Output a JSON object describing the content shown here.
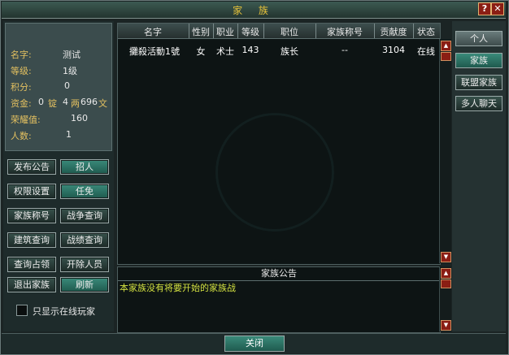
{
  "window": {
    "title": "家 族",
    "help": "?",
    "close": "✕"
  },
  "info": {
    "name_label": "名字:",
    "name_value": "测试",
    "level_label": "等级:",
    "level_value": "1级",
    "points_label": "积分:",
    "points_value": "0",
    "funds_label": "资金:",
    "funds_gold": "0",
    "funds_gold_unit": "锭",
    "funds_silver": "4",
    "funds_silver_unit": "两",
    "funds_copper": "696",
    "funds_copper_unit": "文",
    "honor_label": "荣耀值:",
    "honor_value": "160",
    "members_label": "人数:",
    "members_value": "1"
  },
  "buttons": {
    "post_notice": "发布公告",
    "recruit": "招人",
    "permissions": "权限设置",
    "appoint": "任免",
    "family_title": "家族称号",
    "war_query": "战争查询",
    "building_query": "建筑查询",
    "battle_query": "战绩查询",
    "occupy_query": "查询占领",
    "remove_member": "开除人员",
    "leave_family": "退出家族",
    "refresh": "刷新"
  },
  "online_only_label": "只显示在线玩家",
  "table": {
    "headers": [
      "名字",
      "性别",
      "职业",
      "等级",
      "职位",
      "家族称号",
      "贡献度",
      "状态"
    ],
    "rows": [
      [
        "攤殺活動1號",
        "女",
        "术士",
        "143",
        "族长",
        "--",
        "3104",
        "在线"
      ]
    ]
  },
  "notice": {
    "title": "家族公告",
    "text": "本家族没有将要开始的家族战"
  },
  "tabs": {
    "personal": "个人",
    "family": "家族",
    "alliance": "联盟家族",
    "multichat": "多人聊天"
  },
  "close_label": "关闭"
}
